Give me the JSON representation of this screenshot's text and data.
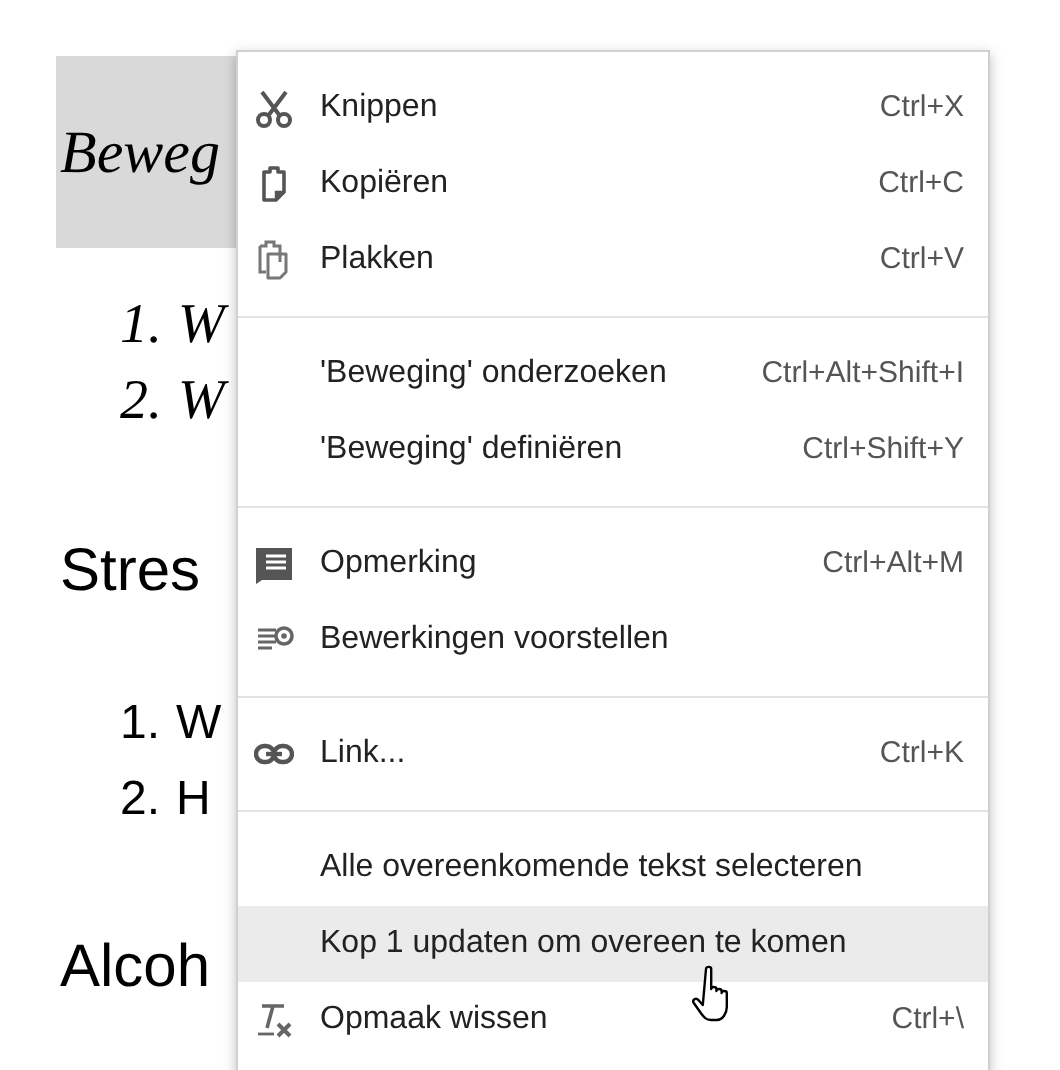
{
  "document": {
    "blocks": [
      {
        "kind": "title",
        "text": "Beweg",
        "selected": true
      },
      {
        "kind": "handlist",
        "items": [
          {
            "number": "1.",
            "text": "W"
          },
          {
            "number": "2.",
            "text": "W"
          }
        ]
      },
      {
        "kind": "heading",
        "text": "Stres",
        "selected": false
      },
      {
        "kind": "list",
        "items": [
          {
            "number": "1.",
            "text": "W"
          },
          {
            "number": "2.",
            "text": "H"
          }
        ]
      },
      {
        "kind": "heading",
        "text": "Alcoh",
        "selected": false
      }
    ]
  },
  "context_menu": {
    "groups": [
      [
        {
          "kind": "scissors",
          "label": "Knippen",
          "shortcut": "Ctrl+X",
          "selected": false
        },
        {
          "kind": "copy",
          "label": "Kopiëren",
          "shortcut": "Ctrl+C",
          "selected": false
        },
        {
          "kind": "paste",
          "label": "Plakken",
          "shortcut": "Ctrl+V",
          "selected": false
        }
      ],
      [
        {
          "label": "'Beweging' onderzoeken",
          "shortcut": "Ctrl+Alt+Shift+I",
          "selected": false
        },
        {
          "label": "'Beweging' definiëren",
          "shortcut": "Ctrl+Shift+Y",
          "selected": false
        }
      ],
      [
        {
          "kind": "comment",
          "label": "Opmerking",
          "shortcut": "Ctrl+Alt+M",
          "selected": false
        },
        {
          "kind": "suggest",
          "label": "Bewerkingen voorstellen",
          "selected": false
        }
      ],
      [
        {
          "kind": "link",
          "label": "Link...",
          "shortcut": "Ctrl+K",
          "selected": false
        }
      ],
      [
        {
          "label": "Alle overeenkomende tekst selecteren",
          "selected": false
        },
        {
          "label": "Kop 1 updaten om overeen te komen",
          "selected": true
        },
        {
          "kind": "clear-format",
          "label": "Opmaak wissen",
          "shortcut": "Ctrl+\\",
          "selected": false
        }
      ]
    ]
  }
}
